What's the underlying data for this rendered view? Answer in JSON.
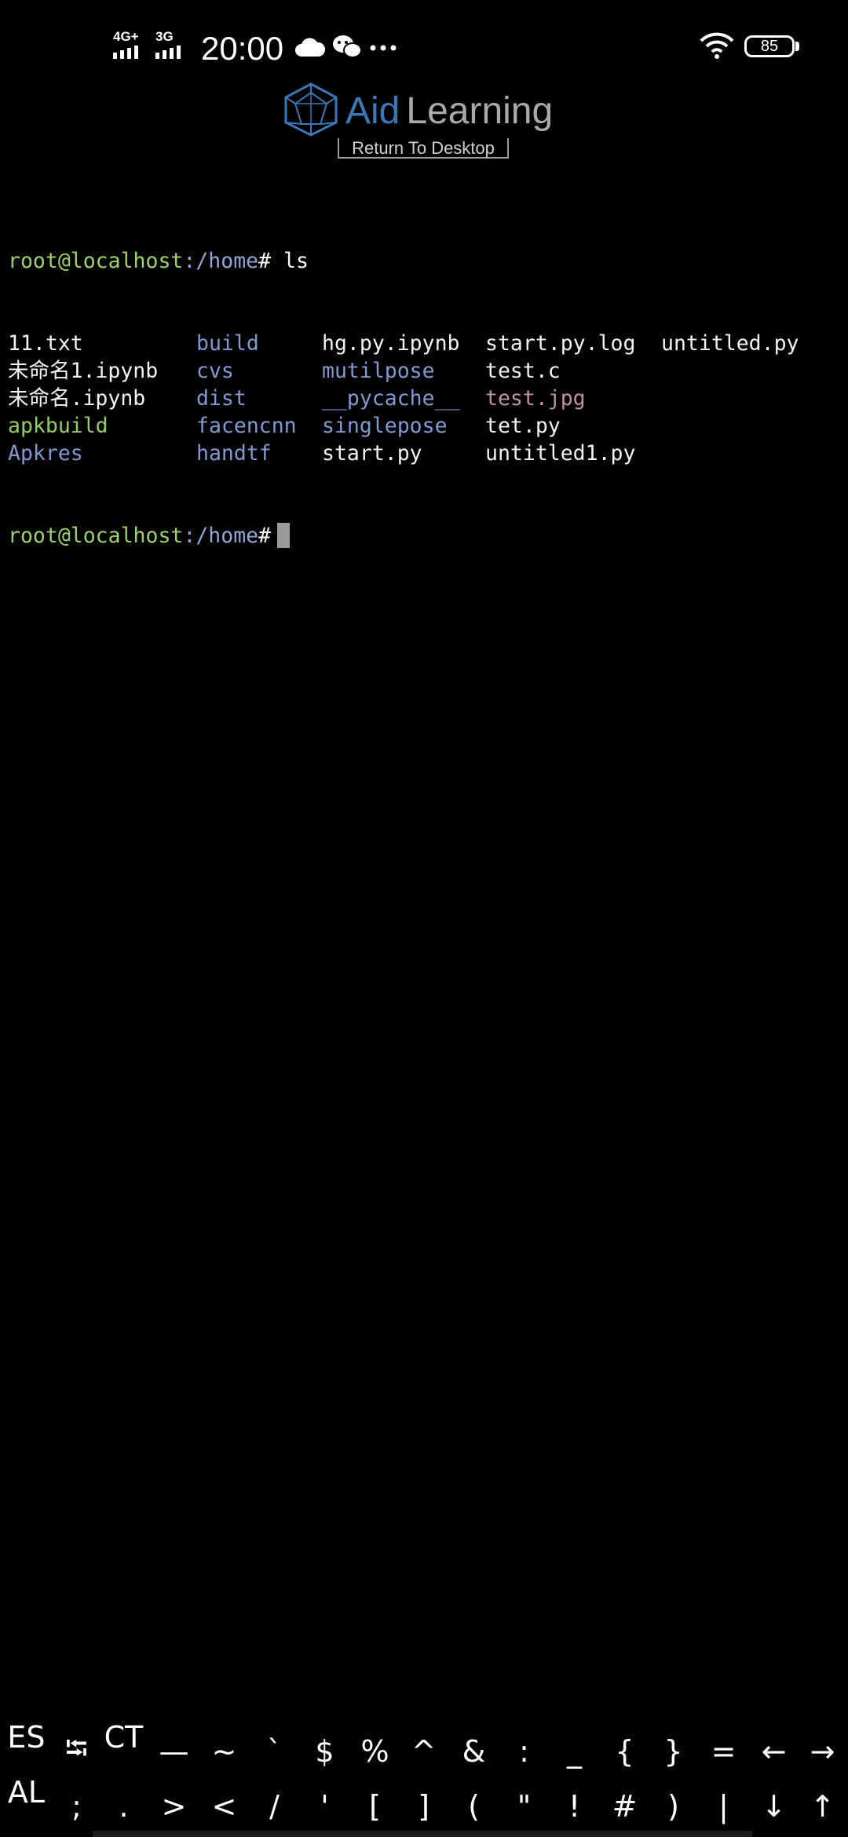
{
  "status_bar": {
    "network1": "4G+",
    "network2": "3G",
    "time": "20:00",
    "battery": "85",
    "icons": [
      "cloud-icon",
      "wechat-icon",
      "more-dots-icon",
      "wifi-icon",
      "battery-icon"
    ]
  },
  "app": {
    "logo_aid": "Aid",
    "logo_learning": "Learning",
    "return_button": "Return To Desktop"
  },
  "terminal": {
    "prompt_user": "root@localhost",
    "prompt_path": ":/home",
    "prompt_symbol": "#",
    "command": " ls",
    "listing": [
      [
        {
          "name": "11.txt",
          "kind": "file"
        },
        {
          "name": "build",
          "kind": "dir"
        },
        {
          "name": "hg.py.ipynb",
          "kind": "file"
        },
        {
          "name": "start.py.log",
          "kind": "file"
        },
        {
          "name": "untitled.py",
          "kind": "file"
        }
      ],
      [
        {
          "name": "未命名1.ipynb",
          "kind": "file"
        },
        {
          "name": "cvs",
          "kind": "dir"
        },
        {
          "name": "mutilpose",
          "kind": "dir"
        },
        {
          "name": "test.c",
          "kind": "file"
        }
      ],
      [
        {
          "name": "未命名.ipynb",
          "kind": "file"
        },
        {
          "name": "dist",
          "kind": "dir"
        },
        {
          "name": "__pycache__",
          "kind": "dir"
        },
        {
          "name": "test.jpg",
          "kind": "image"
        }
      ],
      [
        {
          "name": "apkbuild",
          "kind": "exe"
        },
        {
          "name": "facencnn",
          "kind": "dir"
        },
        {
          "name": "singlepose",
          "kind": "dir"
        },
        {
          "name": "tet.py",
          "kind": "file"
        }
      ],
      [
        {
          "name": "Apkres",
          "kind": "dir"
        },
        {
          "name": "handtf",
          "kind": "dir"
        },
        {
          "name": "start.py",
          "kind": "file"
        },
        {
          "name": "untitled1.py",
          "kind": "file"
        }
      ]
    ]
  },
  "extra_keys": {
    "row1": [
      "ES",
      "⭾",
      "CT",
      "—",
      "~",
      "`",
      "$",
      "%",
      "^",
      "&",
      ":",
      "_",
      "{",
      "}",
      "=",
      "←",
      "→"
    ],
    "row2": [
      "AL",
      ";",
      ".",
      ">",
      "<",
      "/",
      "'",
      "[",
      "]",
      "(",
      "\"",
      "!",
      "#",
      ")",
      "|",
      "↓",
      "↑"
    ]
  },
  "colors": {
    "background": "#000000",
    "prompt_user": "#9ad26a",
    "prompt_path": "#8fa6d6",
    "directory": "#7f9ad3",
    "executable": "#8fcf5a",
    "image": "#c090a8",
    "logo_aid": "#3a78b8",
    "logo_learning": "#a9a9a9"
  }
}
